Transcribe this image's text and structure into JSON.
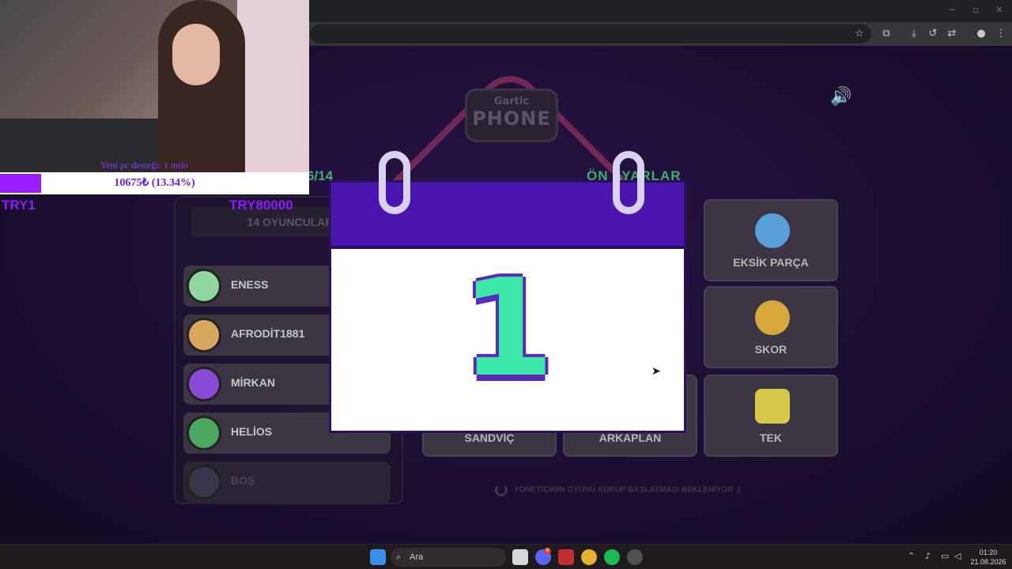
{
  "stream_overlay": {
    "donation_label": "Yeni pc desteği: 1 milo",
    "progress_text": "10675₺ (13.34%)",
    "progress_fraction": 0.1334,
    "min_label": "TRY1",
    "max_label": "TRY80000"
  },
  "game": {
    "logo_line1": "Gartic",
    "logo_line2": "PHONE",
    "player_counter": "6/14",
    "settings_title": "ÖN AYARLAR",
    "players_count_label": "14 OYUNCULAR",
    "players": [
      {
        "name": "ENESS",
        "avatar_color": "#8fd9a0"
      },
      {
        "name": "AFRODİT1881",
        "avatar_color": "#d8a860"
      },
      {
        "name": "MİRKAN",
        "avatar_color": "#8a4ad8"
      },
      {
        "name": "HELİOS",
        "avatar_color": "#4aa860"
      },
      {
        "name": "BOŞ",
        "avatar_color": "#3a3448"
      }
    ],
    "modes": [
      {
        "name": "EKSİK PARÇA"
      },
      {
        "name": "SKOR"
      },
      {
        "name": "SANDVİÇ"
      },
      {
        "name": "ARKAPLAN"
      },
      {
        "name": "TEK"
      }
    ],
    "waiting_text": "YÖNETİCİNİN OYUNU KURUP BAŞLATMASI BEKLENİYOR :)",
    "calendar_number": "1"
  },
  "taskbar": {
    "search_placeholder": "Ara",
    "time": "01:20",
    "date": "21.08.2026",
    "discord_badge": "6"
  },
  "colors": {
    "accent_purple": "#4b16b0",
    "calendar_green": "#3ce8a8",
    "progress_purple": "#9a1cff",
    "game_green_text": "#3fae6e"
  }
}
